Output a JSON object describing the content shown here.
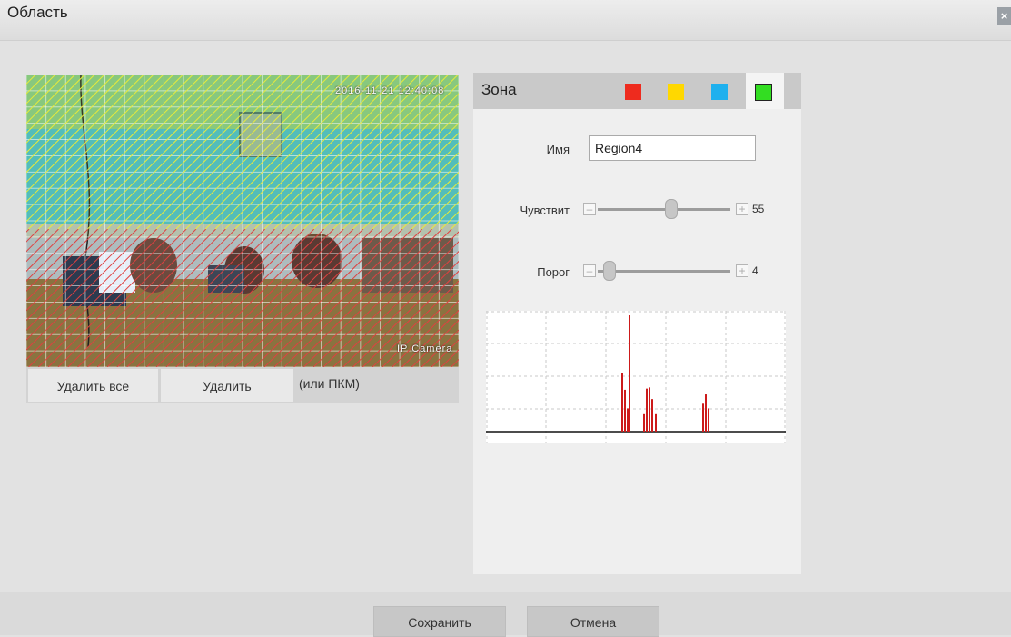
{
  "dialog": {
    "title": "Область",
    "close_icon": "close-icon"
  },
  "preview": {
    "timestamp": "2016-11-21 12:40:08",
    "camera_label": "IP Camera",
    "region_colors": [
      "#e8ea3a",
      "#e04040"
    ]
  },
  "actions": {
    "delete_all_label": "Удалить все",
    "delete_label": "Удалить",
    "hint": "(или ПКМ)"
  },
  "zone_panel": {
    "title": "Зона",
    "swatches": [
      {
        "name": "red",
        "color": "#ee2b1e"
      },
      {
        "name": "yellow",
        "color": "#ffd800"
      },
      {
        "name": "blue",
        "color": "#1eb0ee"
      },
      {
        "name": "green",
        "color": "#33dd22",
        "selected": true
      }
    ],
    "name_label": "Имя",
    "name_value": "Region4",
    "sensitivity_label": "Чувствит",
    "sensitivity_value": "55",
    "sensitivity_fraction": 0.55,
    "threshold_label": "Порог",
    "threshold_value": "4",
    "threshold_fraction": 0.04,
    "graph": {
      "bars": [
        [
          157,
          1.0
        ],
        [
          149,
          0.5
        ],
        [
          152,
          0.36
        ],
        [
          155,
          0.2
        ],
        [
          173,
          0.15
        ],
        [
          176,
          0.37
        ],
        [
          179,
          0.38
        ],
        [
          182,
          0.28
        ],
        [
          186,
          0.15
        ],
        [
          238,
          0.24
        ],
        [
          241,
          0.32
        ],
        [
          244,
          0.2
        ]
      ]
    }
  },
  "footer": {
    "save_label": "Сохранить",
    "cancel_label": "Отмена"
  }
}
